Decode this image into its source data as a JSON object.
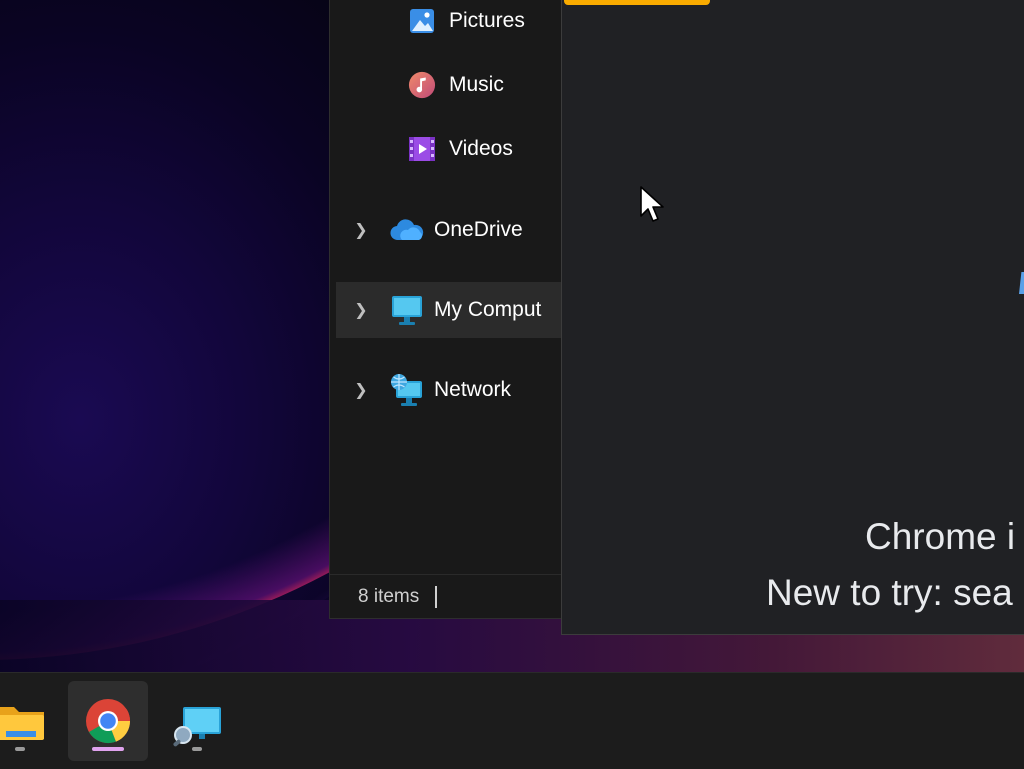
{
  "explorer": {
    "nav": [
      {
        "label": "Pictures",
        "icon": "pictures-icon"
      },
      {
        "label": "Music",
        "icon": "music-icon"
      },
      {
        "label": "Videos",
        "icon": "videos-icon"
      },
      {
        "label": "OneDrive",
        "icon": "onedrive-icon"
      },
      {
        "label": "My Comput",
        "icon": "computer-icon"
      },
      {
        "label": "Network",
        "icon": "network-icon"
      }
    ],
    "status": {
      "item_count": "8 items"
    }
  },
  "chrome": {
    "line1": "Chrome i",
    "line2": "New to try: sea"
  },
  "taskbar": {
    "apps": [
      {
        "name": "File Explorer",
        "icon": "file-explorer-icon"
      },
      {
        "name": "Google Chrome",
        "icon": "chrome-icon"
      },
      {
        "name": "Remote Desktop",
        "icon": "remote-desktop-icon"
      }
    ]
  },
  "colors": {
    "accent_tab": "#f9ab00",
    "chrome_bg": "#202124",
    "explorer_bg": "#191919"
  }
}
